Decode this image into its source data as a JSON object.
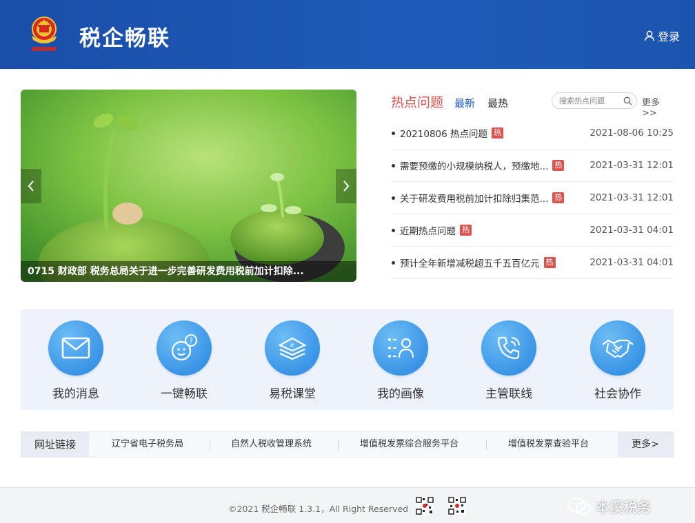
{
  "header": {
    "app_title": "税企畅联",
    "login_label": "登录",
    "brand_color": "#1e5bb9"
  },
  "banner": {
    "caption": "0715 财政部 税务总局关于进一步完善研发费用税前加计扣除..."
  },
  "hot": {
    "tabs": [
      {
        "label": "热点问题",
        "active": true
      },
      {
        "label": "最新",
        "active": false
      },
      {
        "label": "最热",
        "active": false
      }
    ],
    "search_placeholder": "搜索热点问题",
    "more_label": "更多>>",
    "badge": "热",
    "items": [
      {
        "title": "20210806 热点问题",
        "date": "2021-08-06 10:25"
      },
      {
        "title": "需要预缴的小规模纳税人，预缴地...",
        "date": "2021-03-31 12:01"
      },
      {
        "title": "关于研发费用税前加计扣除归集范...",
        "date": "2021-03-31 12:01"
      },
      {
        "title": "近期热点问题",
        "date": "2021-03-31 04:01"
      },
      {
        "title": "预计全年新增减税超五千五百亿元",
        "date": "2021-03-31 04:01"
      }
    ]
  },
  "services": [
    {
      "label": "我的消息",
      "icon": "envelope-icon"
    },
    {
      "label": "一键畅联",
      "icon": "chat-face-icon"
    },
    {
      "label": "易税课堂",
      "icon": "book-stack-icon"
    },
    {
      "label": "我的画像",
      "icon": "profile-list-icon"
    },
    {
      "label": "主管联线",
      "icon": "phone-icon"
    },
    {
      "label": "社会协作",
      "icon": "handshake-icon"
    }
  ],
  "links": {
    "label": "网址链接",
    "items": [
      "辽宁省电子税务局",
      "自然人税收管理系统",
      "增值税发票综合服务平台",
      "增值税发票查验平台"
    ],
    "more_label": "更多>"
  },
  "footer": {
    "copyright": "©2021 税企畅联 1.3.1，All Right Reserved",
    "watermark": "本溪税务"
  }
}
